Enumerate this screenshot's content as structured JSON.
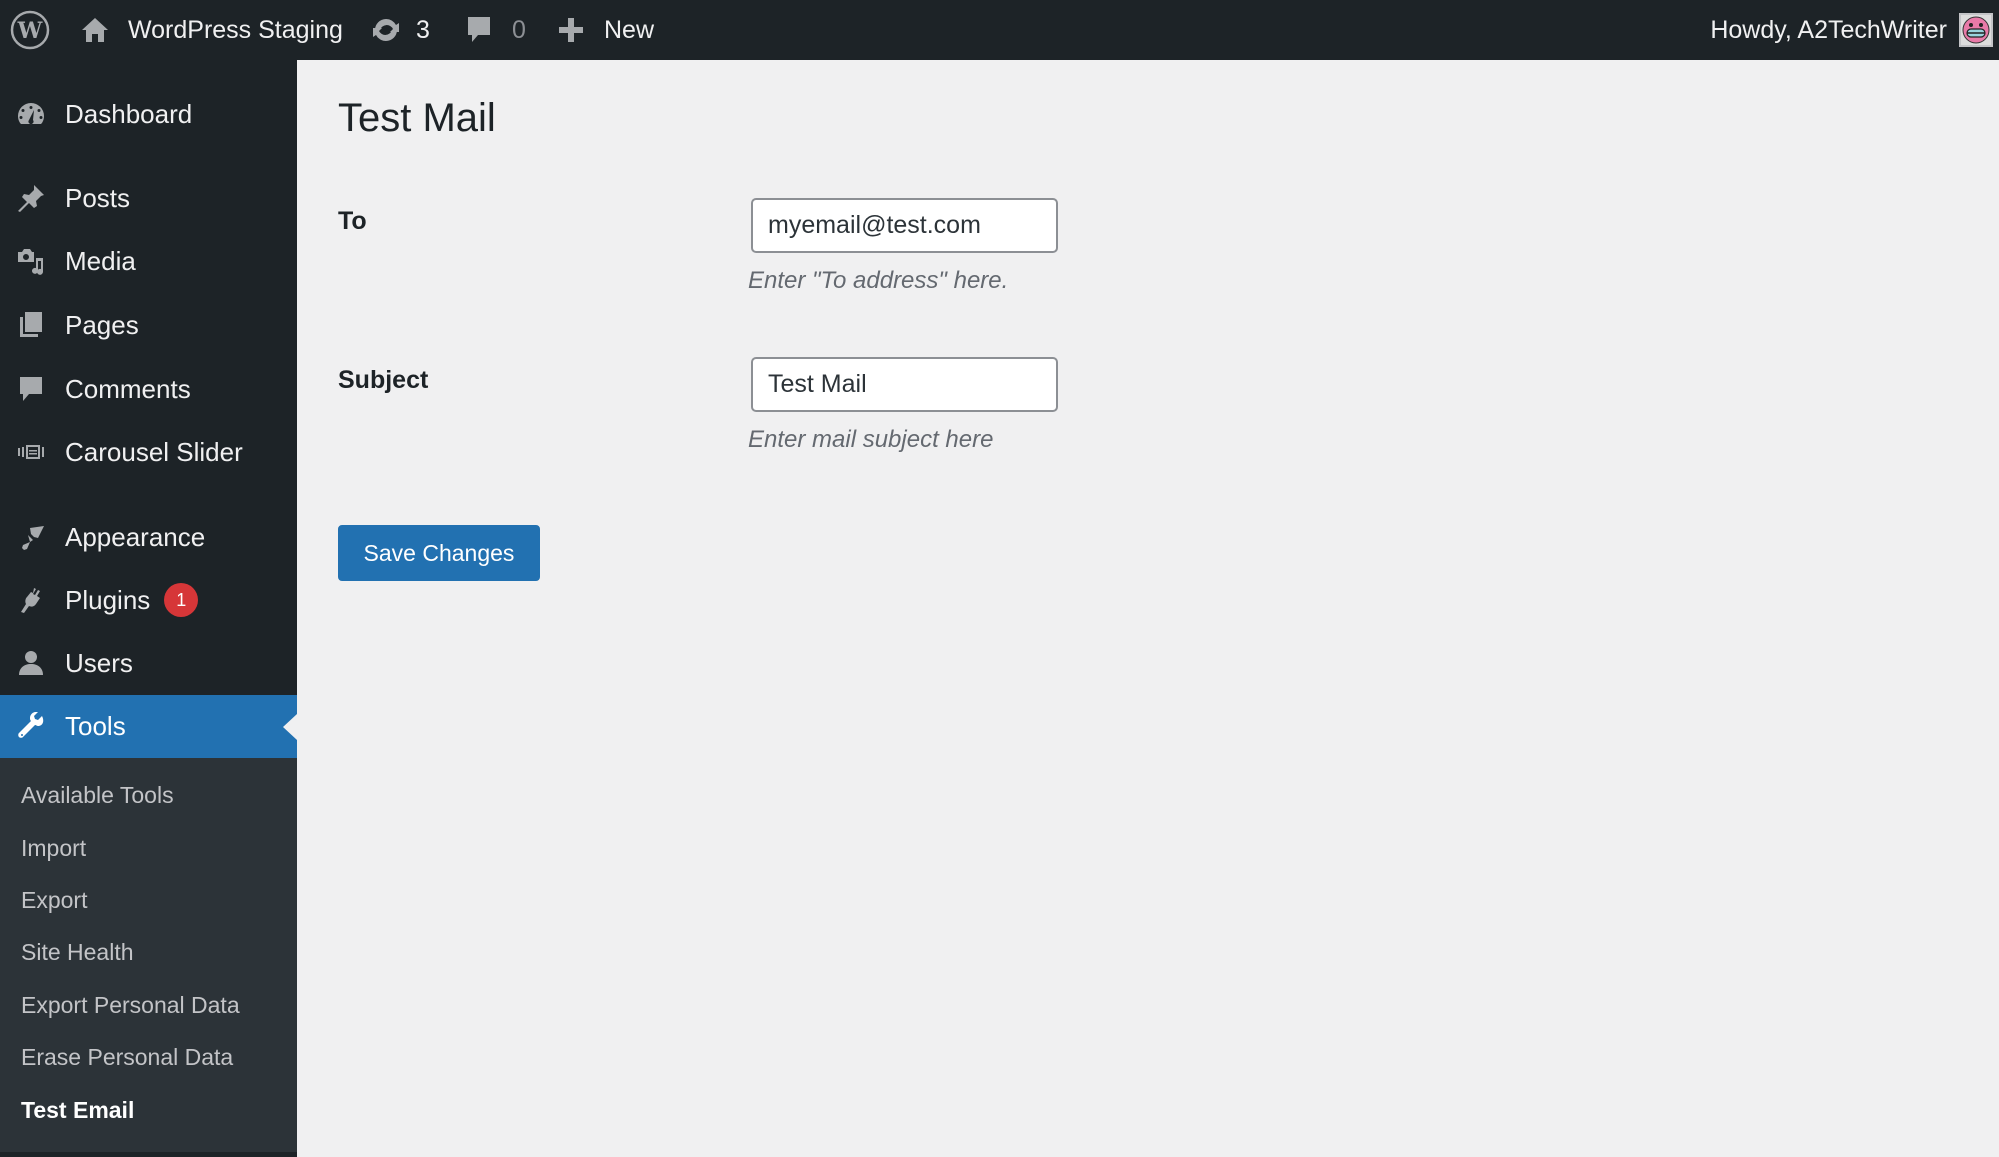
{
  "adminbar": {
    "site_name": "WordPress Staging",
    "updates_count": "3",
    "comments_count": "0",
    "new_label": "New",
    "greeting": "Howdy, A2TechWriter"
  },
  "sidebar": {
    "items": [
      {
        "label": "Dashboard",
        "icon": "dashboard-icon"
      },
      {
        "label": "Posts",
        "icon": "pin-icon"
      },
      {
        "label": "Media",
        "icon": "media-icon"
      },
      {
        "label": "Pages",
        "icon": "pages-icon"
      },
      {
        "label": "Comments",
        "icon": "comment-icon"
      },
      {
        "label": "Carousel Slider",
        "icon": "slides-icon"
      },
      {
        "label": "Appearance",
        "icon": "brush-icon"
      },
      {
        "label": "Plugins",
        "icon": "plug-icon",
        "badge": "1"
      },
      {
        "label": "Users",
        "icon": "user-icon"
      },
      {
        "label": "Tools",
        "icon": "wrench-icon",
        "current": true
      }
    ],
    "submenu": [
      {
        "label": "Available Tools"
      },
      {
        "label": "Import"
      },
      {
        "label": "Export"
      },
      {
        "label": "Site Health"
      },
      {
        "label": "Export Personal Data"
      },
      {
        "label": "Erase Personal Data"
      },
      {
        "label": "Test Email",
        "current": true
      }
    ]
  },
  "main": {
    "title": "Test Mail",
    "fields": {
      "to": {
        "label": "To",
        "value": "myemail@test.com",
        "description": "Enter \"To address\" here."
      },
      "subject": {
        "label": "Subject",
        "value": "Test Mail",
        "description": "Enter mail subject here"
      }
    },
    "save_label": "Save Changes"
  },
  "colors": {
    "admin_bar": "#1d2327",
    "sidebar": "#1d2327",
    "submenu": "#2c3338",
    "accent": "#2271b1",
    "badge": "#d63638",
    "background": "#f0f0f1"
  }
}
